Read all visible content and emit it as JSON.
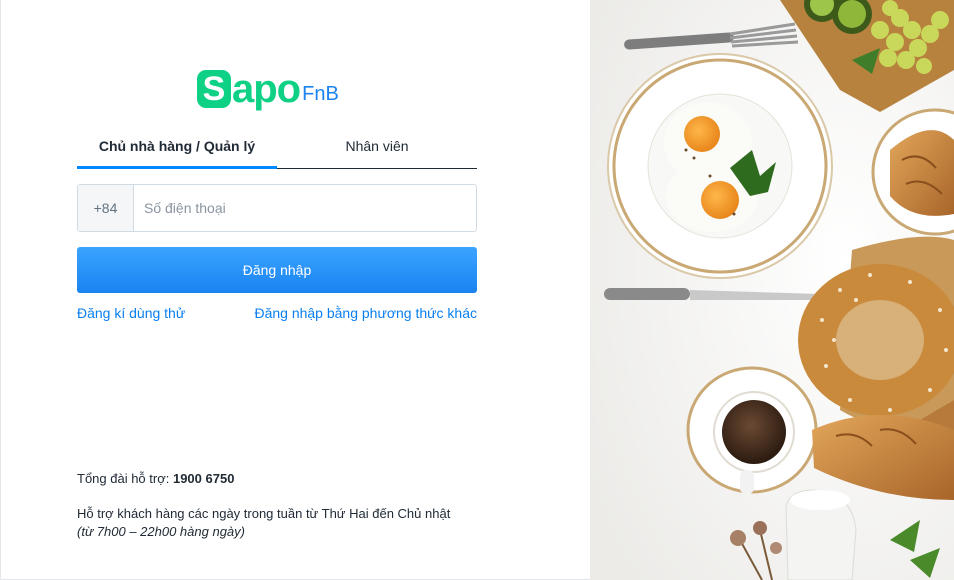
{
  "brand": {
    "mark": "S",
    "word": "apo",
    "suffix": "FnB"
  },
  "tabs": [
    {
      "label": "Chủ nhà hàng / Quản lý",
      "active": true
    },
    {
      "label": "Nhân viên",
      "active": false
    }
  ],
  "phone": {
    "prefix": "+84",
    "placeholder": "Số điện thoại",
    "value": ""
  },
  "login_button": "Đăng nhập",
  "links": {
    "signup": "Đăng kí dùng thử",
    "other_method": "Đăng nhập bằng phương thức khác"
  },
  "support": {
    "hotline_label": "Tổng đài hỗ trợ: ",
    "hotline_number": "1900 6750",
    "days": "Hỗ trợ khách hàng các ngày trong tuần từ Thứ Hai đến Chủ nhật",
    "hours": "(từ 7h00 – 22h00 hàng ngày)"
  },
  "colors": {
    "brand_green": "#0fd186",
    "brand_blue": "#1a83f1",
    "link": "#0a7ff0",
    "tab_underline": "#0088ff"
  }
}
